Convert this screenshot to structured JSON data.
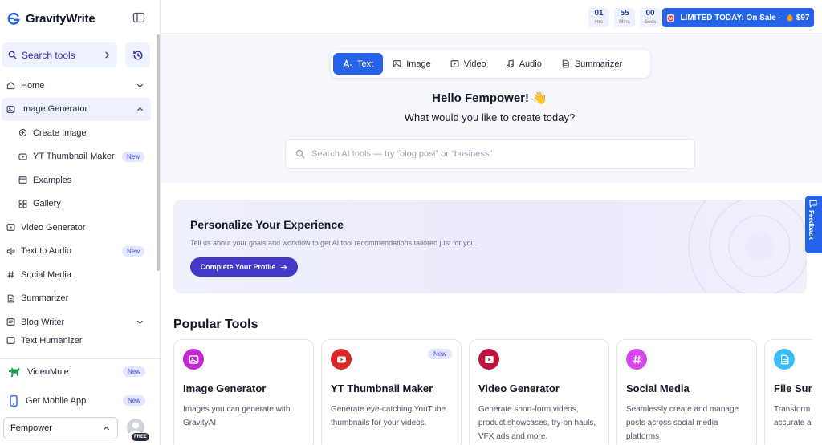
{
  "app": {
    "name": "GravityWrite"
  },
  "sidebar": {
    "search_label": "Search tools",
    "nav": [
      {
        "label": "Home",
        "icon": "home-icon"
      },
      {
        "label": "Image Generator",
        "icon": "image-icon"
      },
      {
        "label": "Create Image",
        "icon": "create-image-icon"
      },
      {
        "label": "YT Thumbnail Maker",
        "icon": "youtube-icon",
        "badge": "New"
      },
      {
        "label": "Examples",
        "icon": "examples-icon"
      },
      {
        "label": "Gallery",
        "icon": "gallery-icon"
      },
      {
        "label": "Video Generator",
        "icon": "video-icon"
      },
      {
        "label": "Text to Audio",
        "icon": "audio-icon",
        "badge": "New"
      },
      {
        "label": "Social Media",
        "icon": "hash-icon"
      },
      {
        "label": "Summarizer",
        "icon": "document-icon"
      },
      {
        "label": "Blog Writer",
        "icon": "blog-icon"
      },
      {
        "label": "Text Humanizer",
        "icon": "humanizer-icon"
      }
    ],
    "videomule": {
      "label": "VideoMule",
      "badge": "New"
    },
    "mobile": {
      "label": "Get Mobile App",
      "badge": "New"
    },
    "workspace": "Fempower",
    "plan_badge": "FREE"
  },
  "topbar": {
    "timer": [
      {
        "value": "01",
        "unit": "Hrs"
      },
      {
        "value": "55",
        "unit": "Mins"
      },
      {
        "value": "00",
        "unit": "Secs"
      }
    ],
    "sale_label": "LIMITED TODAY: On Sale -",
    "sale_price": "$97"
  },
  "hero": {
    "tabs": [
      "Text",
      "Image",
      "Video",
      "Audio",
      "Summarizer"
    ],
    "greeting": "Hello Fempower! 👋",
    "subtitle": "What would you like to create today?",
    "search_placeholder": "Search AI tools — try “blog post” or “business”"
  },
  "personalize": {
    "title": "Personalize Your Experience",
    "description": "Tell us about your goals and workflow to get AI tool recommendations tailored just for you.",
    "cta": "Complete Your Profile"
  },
  "feedback_label": "Feedback",
  "popular": {
    "heading": "Popular Tools",
    "tools": [
      {
        "title": "Image Generator",
        "description": "Images you can generate with GravityAI",
        "color": "#c026d3"
      },
      {
        "title": "YT Thumbnail Maker",
        "description": "Generate eye-catching YouTube thumbnails for your videos.",
        "badge": "New",
        "color": "#dc2626"
      },
      {
        "title": "Video Generator",
        "description": "Generate short-form videos, product showcases, try-on hauls, VFX ads and more.",
        "color": "#be123c"
      },
      {
        "title": "Social Media",
        "description": "Seamlessly create and manage posts across social media platforms",
        "color": "#d946ef"
      },
      {
        "title": "File Summarizer",
        "description": "Transform lengthy files into accurate and concise summaries",
        "color": "#38bdf8"
      }
    ]
  }
}
